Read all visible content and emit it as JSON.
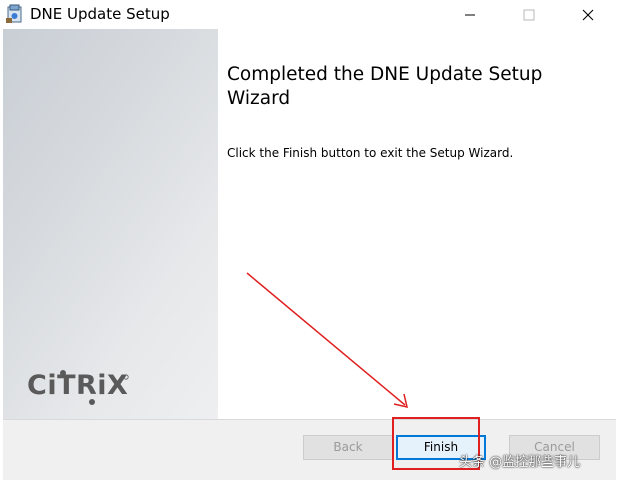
{
  "window": {
    "title": "DNE Update Setup",
    "icon": "installer-icon"
  },
  "side_panel": {
    "logo_text": "CiTRiX"
  },
  "content": {
    "heading": "Completed the DNE Update Setup Wizard",
    "body": "Click the Finish button to exit the Setup Wizard."
  },
  "buttons": {
    "back": "Back",
    "finish": "Finish",
    "cancel": "Cancel"
  },
  "overlay": {
    "watermark": "头条 @监控那些事儿"
  },
  "colors": {
    "accent": "#0078d7",
    "annotation": "#e02020"
  }
}
